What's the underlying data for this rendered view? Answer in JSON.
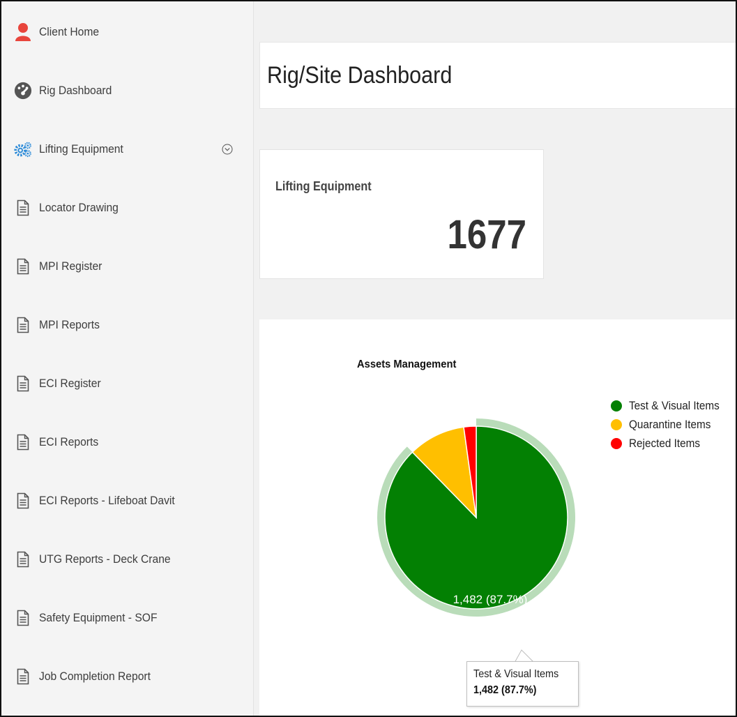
{
  "sidebar": {
    "items": [
      {
        "label": "Client Home",
        "icon": "user-icon",
        "color": "#e8453c"
      },
      {
        "label": "Rig Dashboard",
        "icon": "dashboard-gauge-icon",
        "color": "#555555"
      },
      {
        "label": "Lifting Equipment",
        "icon": "gears-icon",
        "color": "#2b8ad8",
        "expandable": true
      },
      {
        "label": "Locator Drawing",
        "icon": "document-icon"
      },
      {
        "label": "MPI Register",
        "icon": "document-icon"
      },
      {
        "label": "MPI Reports",
        "icon": "document-icon"
      },
      {
        "label": "ECI Register",
        "icon": "document-icon"
      },
      {
        "label": "ECI Reports",
        "icon": "document-icon"
      },
      {
        "label": "ECI Reports - Lifeboat Davit",
        "icon": "document-icon"
      },
      {
        "label": "UTG Reports - Deck Crane",
        "icon": "document-icon"
      },
      {
        "label": "Safety Equipment - SOF",
        "icon": "document-icon"
      },
      {
        "label": "Job Completion Report",
        "icon": "document-icon"
      }
    ]
  },
  "page": {
    "title": "Rig/Site Dashboard"
  },
  "stat_card": {
    "label": "Lifting Equipment",
    "value": "1677"
  },
  "chart_data": {
    "type": "pie",
    "title": "Assets Management",
    "slices": [
      {
        "name": "Test & Visual Items",
        "value": 1482,
        "percent": 87.7,
        "color": "#038003"
      },
      {
        "name": "Quarantine Items",
        "value": 171,
        "percent": 10.1,
        "color": "#ffbf00"
      },
      {
        "name": "Rejected Items",
        "value": 37,
        "percent": 2.2,
        "color": "#ff0000"
      }
    ],
    "data_label": "1,482 (87.7%)",
    "highlighted": "Test & Visual Items",
    "legend_position": "right"
  },
  "tooltip": {
    "name": "Test & Visual Items",
    "value": "1,482 (87.7%)"
  }
}
